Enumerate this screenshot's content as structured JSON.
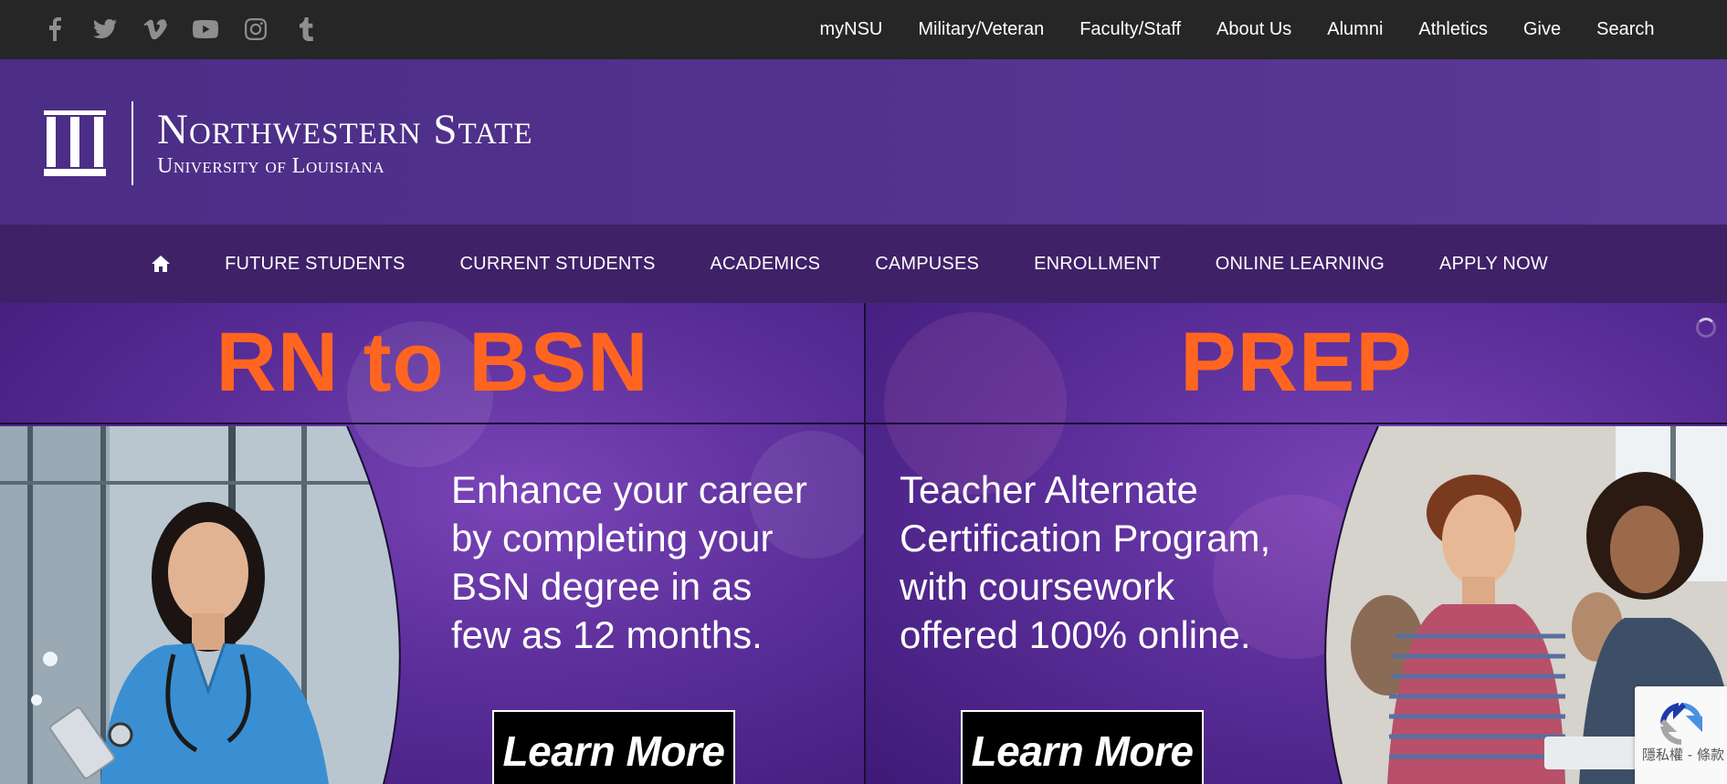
{
  "topbar": {
    "social": [
      {
        "icon": "facebook-icon"
      },
      {
        "icon": "twitter-icon"
      },
      {
        "icon": "vimeo-icon"
      },
      {
        "icon": "youtube-icon"
      },
      {
        "icon": "instagram-icon"
      },
      {
        "icon": "tumblr-icon"
      }
    ],
    "utility_links": [
      "myNSU",
      "Military/Veteran",
      "Faculty/Staff",
      "About Us",
      "Alumni",
      "Athletics",
      "Give",
      "Search"
    ]
  },
  "header": {
    "logo_line1": "Northwestern State",
    "logo_line2": "University of Louisiana"
  },
  "mainnav": {
    "home_icon": "home-icon",
    "items": [
      "FUTURE STUDENTS",
      "CURRENT STUDENTS",
      "ACADEMICS",
      "CAMPUSES",
      "ENROLLMENT",
      "ONLINE LEARNING",
      "APPLY NOW"
    ]
  },
  "banners": {
    "left": {
      "headline": "RN to BSN",
      "copy": [
        "Enhance your career",
        "by completing your",
        "BSN degree in as",
        "few as 12 months."
      ],
      "button": "Learn More"
    },
    "right": {
      "headline": "PREP",
      "copy": [
        "Teacher Alternate",
        "Certification Program,",
        "with coursework",
        "offered 100% online."
      ],
      "button": "Learn More"
    }
  },
  "recaptcha": {
    "text": "隱私權 - 條款"
  },
  "colors": {
    "topbar": "#262626",
    "header_purple": "#4e2e86",
    "nav_purple": "#3f2168",
    "headline_orange": "#ff6520"
  }
}
